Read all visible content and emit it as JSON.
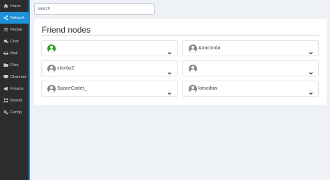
{
  "sidebar": {
    "items": [
      {
        "label": "Home",
        "icon": "home-icon",
        "active": false
      },
      {
        "label": "Network",
        "icon": "share-icon",
        "active": true
      },
      {
        "label": "People",
        "icon": "users-icon",
        "active": false
      },
      {
        "label": "Chat",
        "icon": "chat-icon",
        "active": false
      },
      {
        "label": "Mail",
        "icon": "mail-icon",
        "active": false
      },
      {
        "label": "Files",
        "icon": "folder-icon",
        "active": false
      },
      {
        "label": "Channels",
        "icon": "monitor-icon",
        "active": false
      },
      {
        "label": "Forums",
        "icon": "megaphone-icon",
        "active": false
      },
      {
        "label": "Boards",
        "icon": "boards-icon",
        "active": false
      },
      {
        "label": "Config",
        "icon": "gears-icon",
        "active": false
      }
    ]
  },
  "search": {
    "placeholder": "search",
    "value": ""
  },
  "main": {
    "title": "Friend nodes",
    "nodes": [
      {
        "name": "",
        "status": "online"
      },
      {
        "name": "Anaconda",
        "status": "offline"
      },
      {
        "name": "skorby2",
        "status": "offline"
      },
      {
        "name": "",
        "status": "offline"
      },
      {
        "name": "SpaceCadet_",
        "status": "offline"
      },
      {
        "name": "kimcdow",
        "status": "offline"
      }
    ]
  },
  "colors": {
    "sidebar_bg": "#2c2c2c",
    "accent": "#1e90d8",
    "online": "#2ea02e",
    "offline": "#888888",
    "page_bg": "#eef2f6"
  }
}
